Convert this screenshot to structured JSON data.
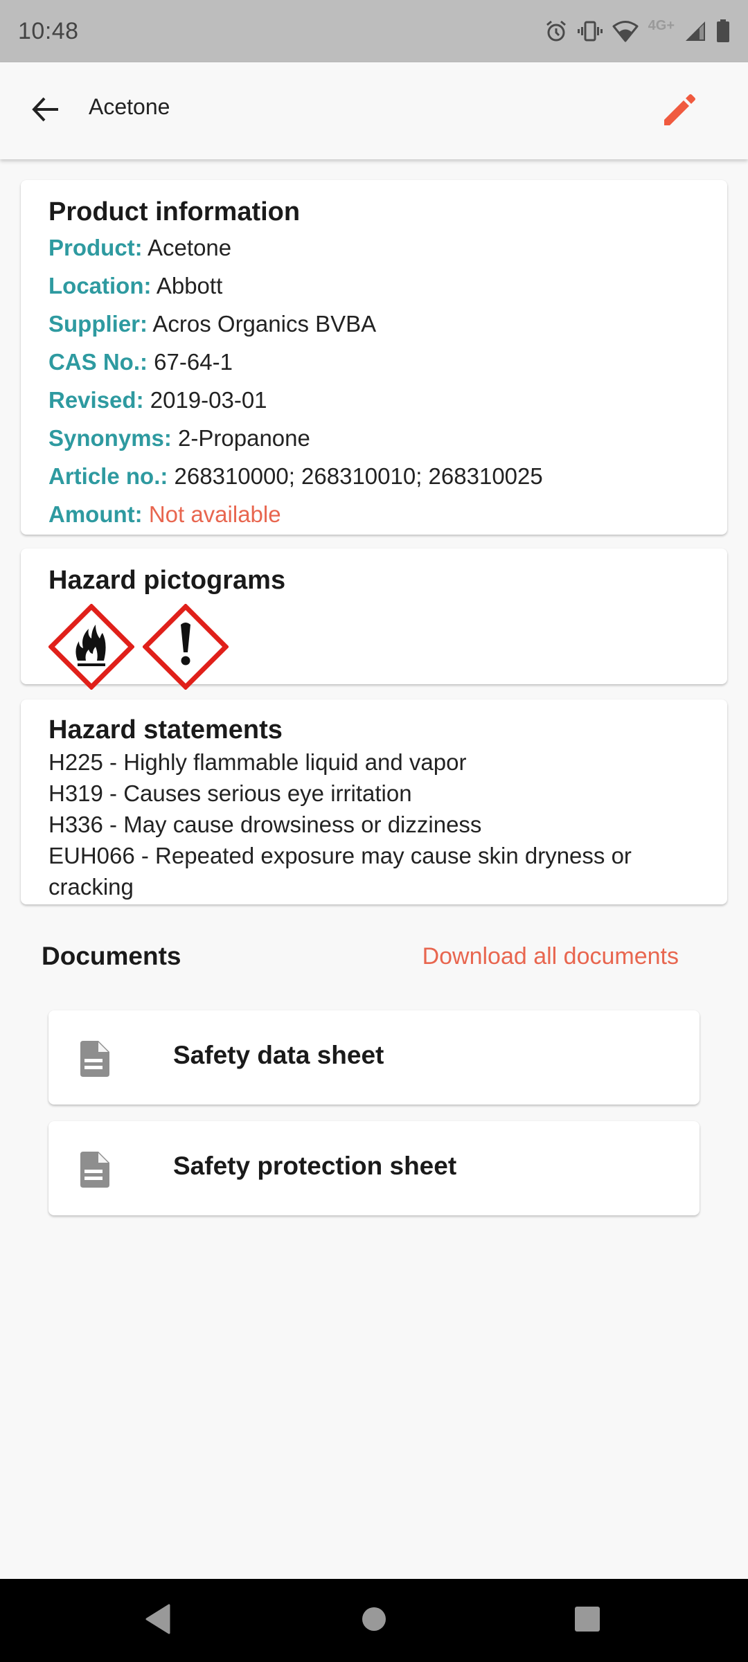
{
  "status_bar": {
    "time": "10:48",
    "network": "4G+",
    "icons": [
      "alarm-icon",
      "vibrate-icon",
      "wifi-icon",
      "signal-icon",
      "battery-icon"
    ]
  },
  "app_bar": {
    "title": "Acetone",
    "back_icon": "arrow-left-icon",
    "edit_icon": "pencil-icon"
  },
  "colors": {
    "accent": "#e8664f",
    "label": "#2e9aa0",
    "hazard_red": "#e0201a"
  },
  "product_info": {
    "title": "Product information",
    "rows": [
      {
        "label": "Product:",
        "value": "Acetone"
      },
      {
        "label": "Location:",
        "value": "Abbott"
      },
      {
        "label": "Supplier:",
        "value": "Acros Organics BVBA"
      },
      {
        "label": "CAS No.:",
        "value": "67-64-1"
      },
      {
        "label": "Revised:",
        "value": "2019-03-01"
      },
      {
        "label": "Synonyms:",
        "value": "2-Propanone"
      },
      {
        "label": "Article no.:",
        "value": "268310000; 268310010; 268310025"
      },
      {
        "label": "Amount:",
        "value": "Not available"
      }
    ]
  },
  "hazard_pictograms": {
    "title": "Hazard pictograms",
    "items": [
      "flame-pictogram",
      "exclamation-pictogram"
    ]
  },
  "hazard_statements": {
    "title": "Hazard statements",
    "items": [
      "H225 - Highly flammable liquid and vapor",
      "H319 - Causes serious eye irritation",
      "H336 - May cause drowsiness or dizziness",
      "EUH066 - Repeated exposure may cause skin dryness or cracking"
    ]
  },
  "documents": {
    "title": "Documents",
    "download_all_label": "Download all documents",
    "items": [
      {
        "label": "Safety data sheet",
        "icon": "document-icon"
      },
      {
        "label": "Safety protection sheet",
        "icon": "document-icon"
      }
    ]
  },
  "nav_bar": {
    "buttons": [
      "back",
      "home",
      "recents"
    ]
  }
}
